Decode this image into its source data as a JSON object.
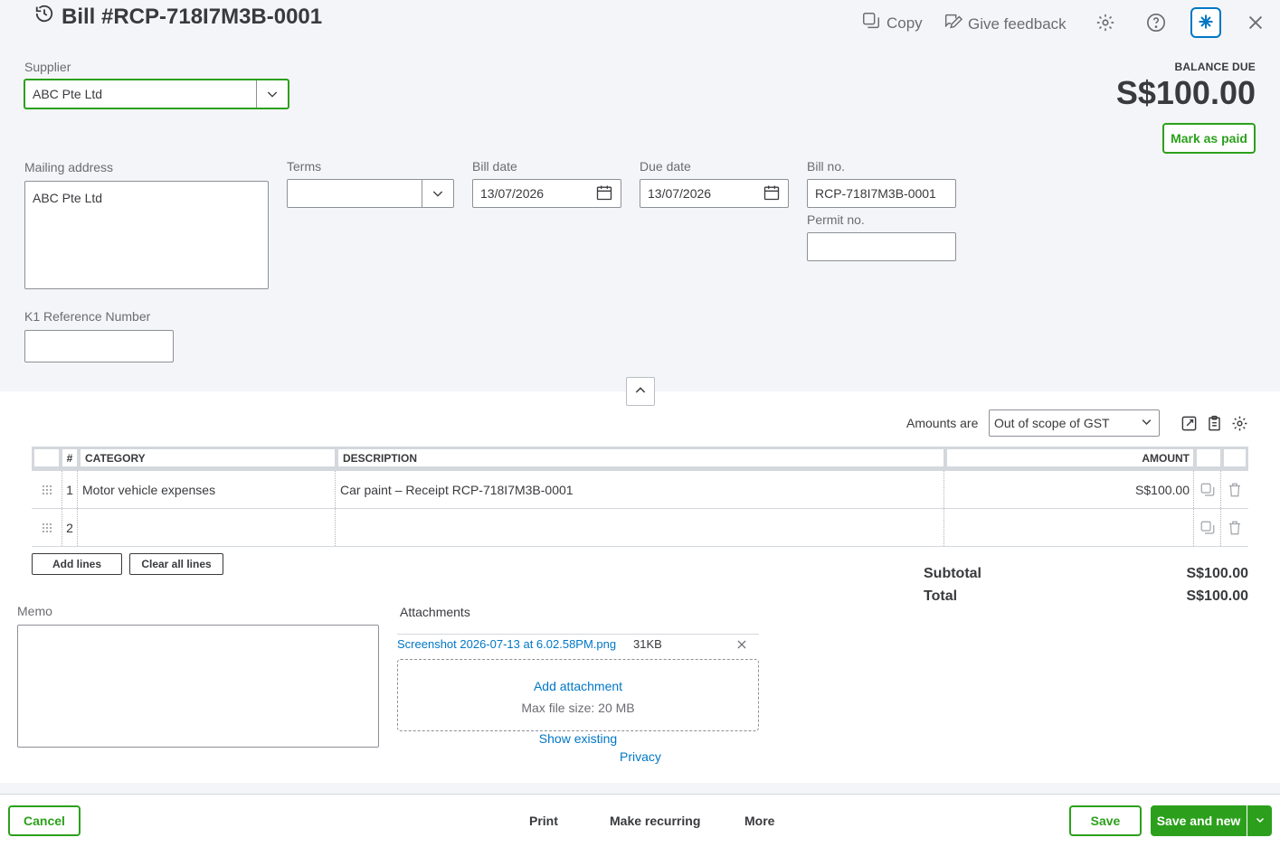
{
  "header": {
    "title": "Bill #RCP-718I7M3B-0001",
    "copy_label": "Copy",
    "feedback_label": "Give feedback"
  },
  "supplier": {
    "label": "Supplier",
    "value": "ABC Pte Ltd"
  },
  "balance": {
    "label": "BALANCE DUE",
    "amount": "S$100.00",
    "mark_paid_label": "Mark as paid"
  },
  "mailing": {
    "label": "Mailing address",
    "value": "ABC Pte Ltd"
  },
  "terms": {
    "label": "Terms",
    "value": ""
  },
  "bill_date": {
    "label": "Bill date",
    "value": "13/07/2026"
  },
  "due_date": {
    "label": "Due date",
    "value": "13/07/2026"
  },
  "bill_no": {
    "label": "Bill no.",
    "value": "RCP-718I7M3B-0001"
  },
  "permit_no": {
    "label": "Permit no.",
    "value": ""
  },
  "k1": {
    "label": "K1 Reference Number",
    "value": ""
  },
  "amounts": {
    "label": "Amounts are",
    "value": "Out of scope of GST"
  },
  "table": {
    "headers": {
      "num": "#",
      "category": "CATEGORY",
      "description": "DESCRIPTION",
      "amount": "AMOUNT"
    },
    "rows": [
      {
        "num": "1",
        "category": "Motor vehicle expenses",
        "description": "Car paint – Receipt RCP-718I7M3B-0001",
        "amount": "S$100.00"
      },
      {
        "num": "2",
        "category": "",
        "description": "",
        "amount": ""
      }
    ],
    "add_lines_label": "Add lines",
    "clear_lines_label": "Clear all lines"
  },
  "totals": {
    "subtotal_label": "Subtotal",
    "subtotal": "S$100.00",
    "total_label": "Total",
    "total": "S$100.00"
  },
  "memo": {
    "label": "Memo"
  },
  "attachments": {
    "label": "Attachments",
    "file_name": "Screenshot 2026-07-13 at 6.02.58PM.png",
    "file_size": "31KB",
    "add_label": "Add attachment",
    "max_size": "Max file size: 20 MB",
    "show_existing": "Show existing",
    "privacy": "Privacy"
  },
  "footer": {
    "cancel": "Cancel",
    "print": "Print",
    "recurring": "Make recurring",
    "more": "More",
    "save": "Save",
    "save_new": "Save and new"
  },
  "colors": {
    "accent": "#2ca01c",
    "link": "#0077c5",
    "background": "#f4f5f8"
  }
}
